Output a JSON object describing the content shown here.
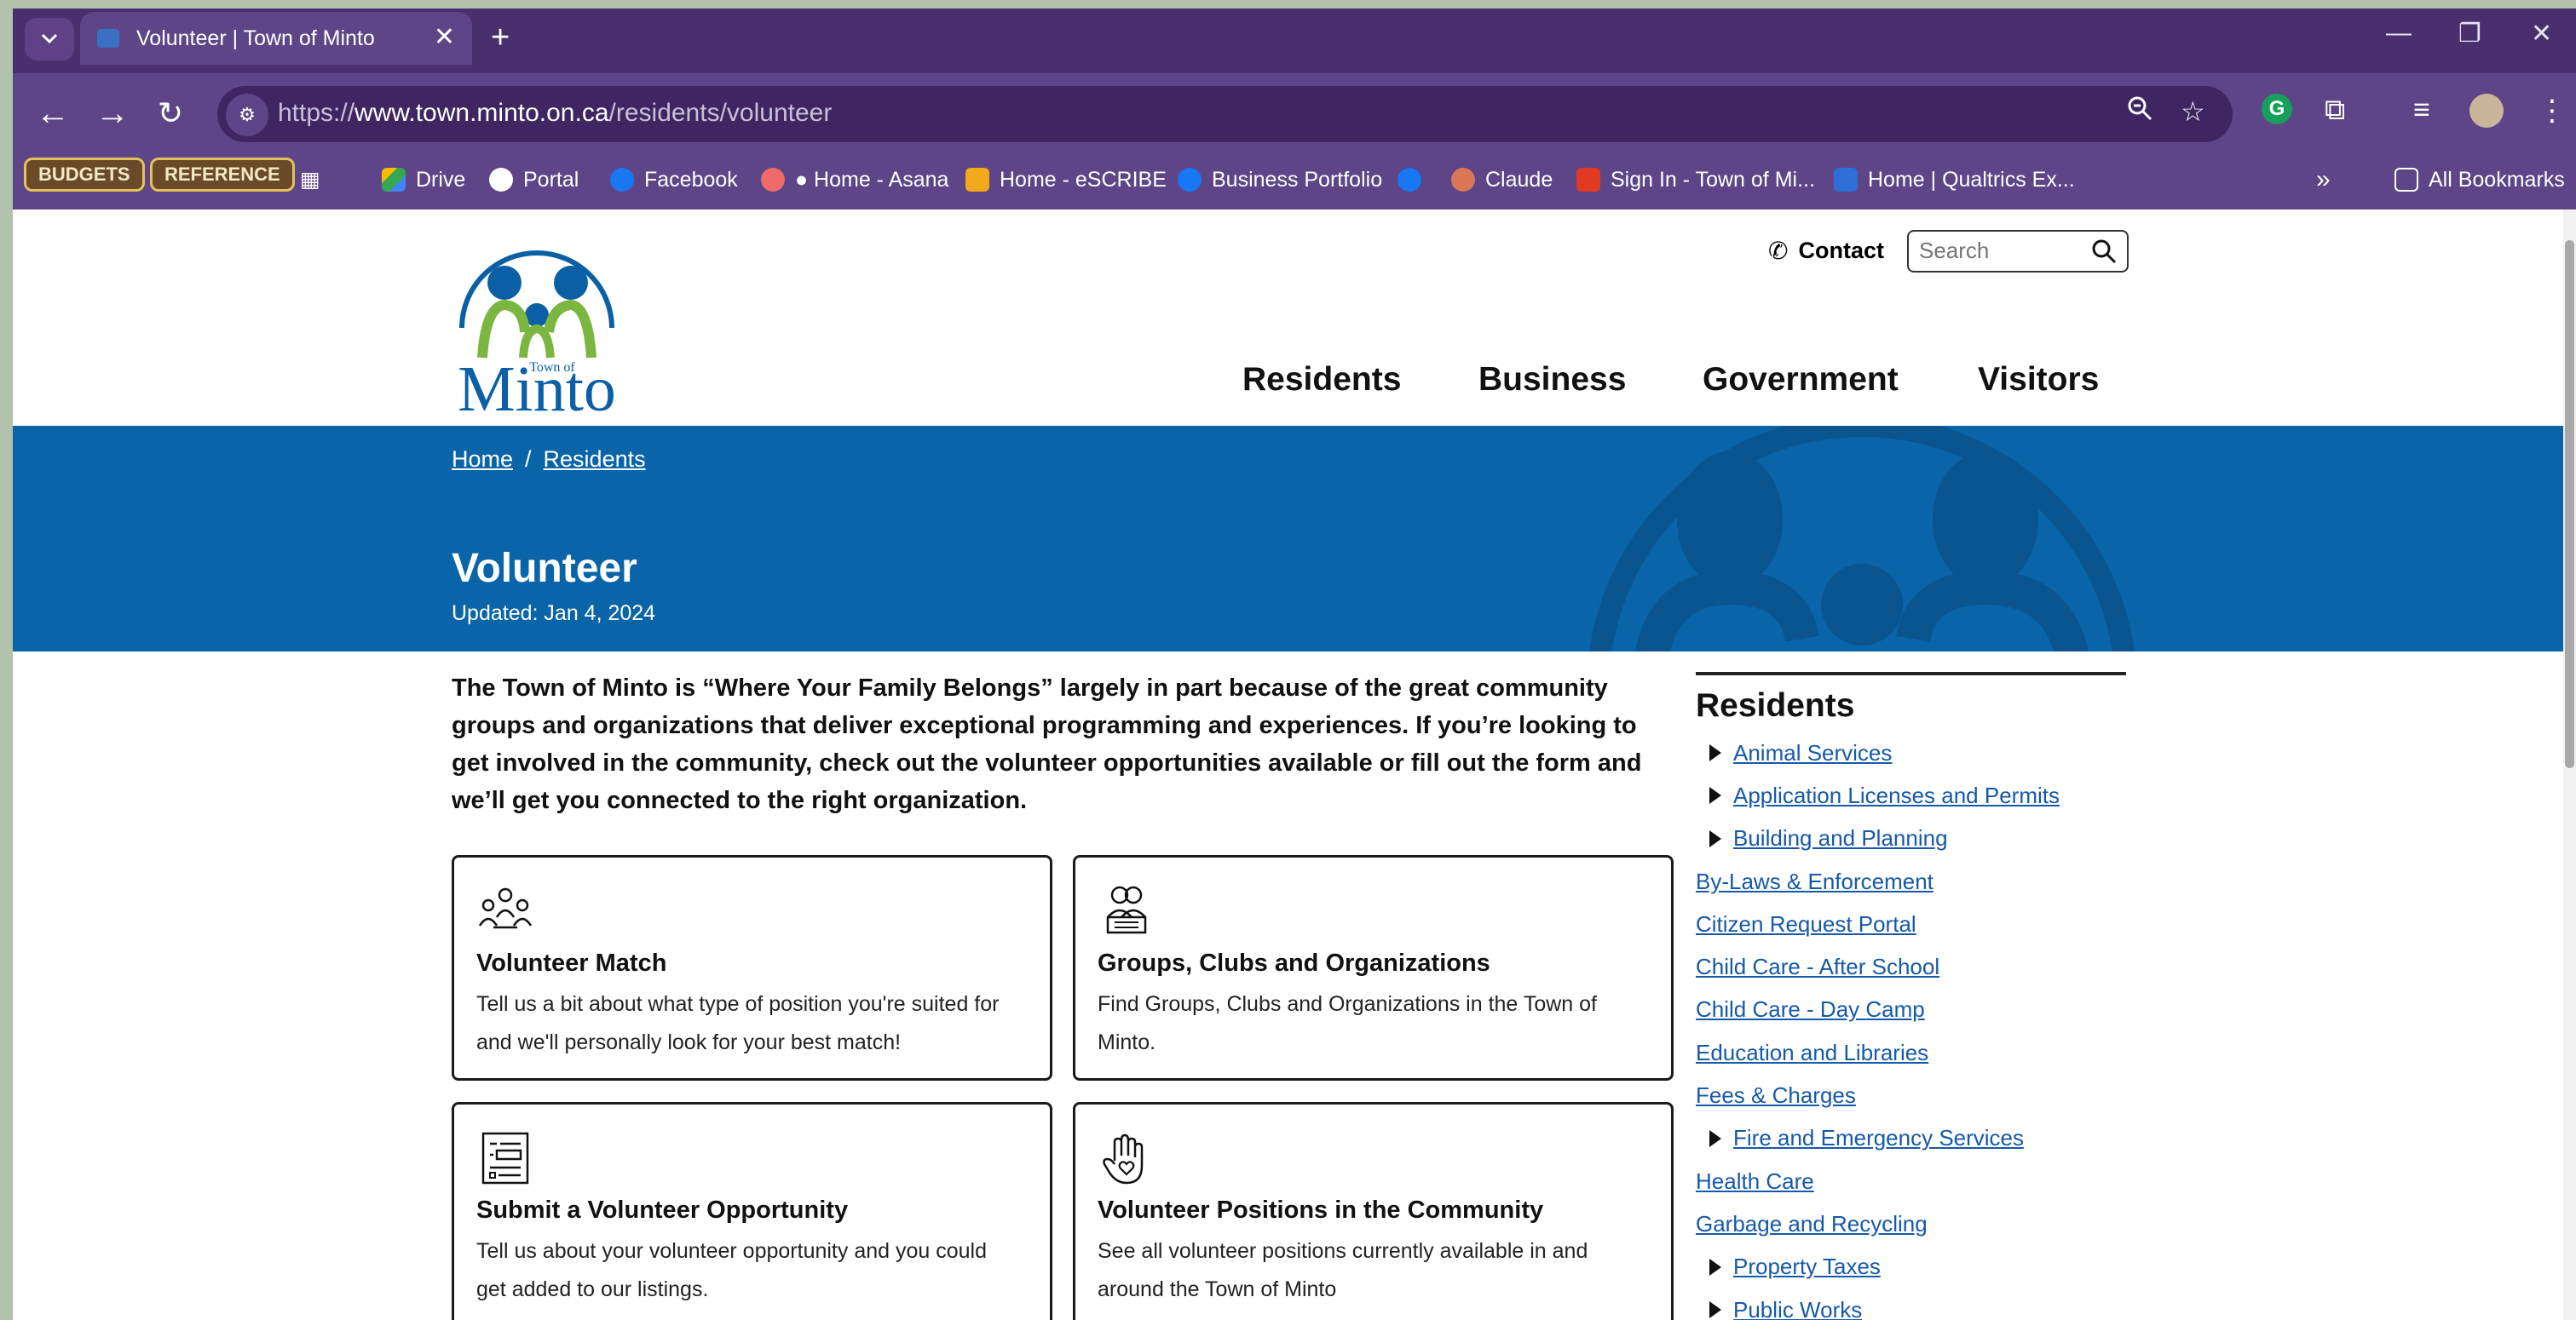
{
  "browser": {
    "tab_title": "Volunteer | Town of Minto",
    "url_prefix": "https://",
    "url_domain": "www.town.minto.on.ca",
    "url_path": "/residents/volunteer",
    "bookmarks": [
      {
        "label": "BUDGETS"
      },
      {
        "label": "REFERENCE"
      },
      {
        "label": "Drive"
      },
      {
        "label": "Portal"
      },
      {
        "label": "Facebook"
      },
      {
        "label": "● Home - Asana"
      },
      {
        "label": "Home - eSCRIBE"
      },
      {
        "label": "Business Portfolio"
      },
      {
        "label": "Claude"
      },
      {
        "label": "Sign In - Town of Mi..."
      },
      {
        "label": "Home | Qualtrics Ex..."
      },
      {
        "label": "All Bookmarks"
      }
    ]
  },
  "header": {
    "logo_text": "Minto",
    "logo_small": "Town of",
    "contact": "Contact",
    "search_placeholder": "Search",
    "nav": [
      "Residents",
      "Business",
      "Government",
      "Visitors"
    ]
  },
  "hero": {
    "breadcrumb": [
      "Home",
      "Residents"
    ],
    "title": "Volunteer",
    "updated": "Updated: Jan 4, 2024"
  },
  "intro": "The Town of Minto is “Where Your Family Belongs” largely in part because of the great community groups and organizations that deliver exceptional programming and experiences. If you’re looking to get involved in the community, check out the volunteer opportunities available or fill out the form and we’ll get you connected to the right organization.",
  "cards": [
    {
      "title": "Volunteer Match",
      "desc": "Tell us a bit about what type of position you're suited for and we'll personally look for your best match!",
      "icon": "people-meeting-icon"
    },
    {
      "title": "Groups, Clubs and Organizations",
      "desc": "Find Groups, Clubs and Organizations in the Town of Minto.",
      "icon": "group-icon"
    },
    {
      "title": "Submit a Volunteer Opportunity",
      "desc": "Tell us about your volunteer opportunity and you could get added to our listings.",
      "icon": "form-icon"
    },
    {
      "title": "Volunteer Positions in the Community",
      "desc": "See all volunteer positions currently available in and around the Town of Minto",
      "icon": "hand-heart-icon"
    }
  ],
  "sidebar": {
    "title": "Residents",
    "items": [
      {
        "label": "Animal Services",
        "expandable": true
      },
      {
        "label": "Application Licenses and Permits",
        "expandable": true
      },
      {
        "label": "Building and Planning",
        "expandable": true
      },
      {
        "label": "By-Laws & Enforcement",
        "expandable": false
      },
      {
        "label": "Citizen Request Portal",
        "expandable": false
      },
      {
        "label": "Child Care - After School",
        "expandable": false
      },
      {
        "label": "Child Care - Day Camp",
        "expandable": false
      },
      {
        "label": "Education and Libraries",
        "expandable": false
      },
      {
        "label": "Fees & Charges",
        "expandable": false
      },
      {
        "label": "Fire and Emergency Services",
        "expandable": true
      },
      {
        "label": "Health Care",
        "expandable": false
      },
      {
        "label": "Garbage and Recycling",
        "expandable": false
      },
      {
        "label": "Property Taxes",
        "expandable": true
      },
      {
        "label": "Public Works",
        "expandable": true
      }
    ]
  },
  "colors": {
    "hero_blue": "#0964a8",
    "link_blue": "#1659a8",
    "chrome_purple": "#5e4587"
  }
}
